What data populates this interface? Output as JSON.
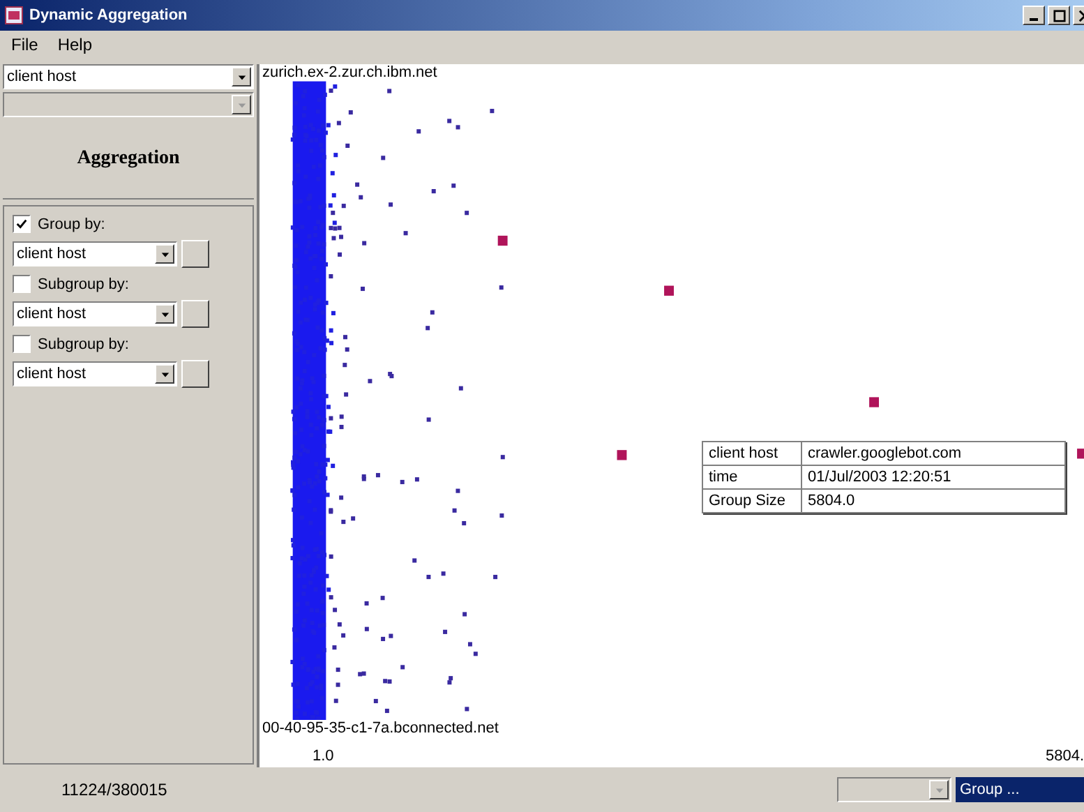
{
  "window": {
    "title": "Dynamic Aggregation"
  },
  "menu": [
    "File",
    "Help"
  ],
  "sidebar": {
    "attribute_combo": {
      "value": "client host"
    },
    "second_combo": {
      "disabled": true
    },
    "heading": "Aggregation",
    "groups": [
      {
        "label": "Group by:",
        "checked": true,
        "value": "client host"
      },
      {
        "label": "Subgroup by:",
        "checked": false,
        "value": "client host"
      },
      {
        "label": "Subgroup by:",
        "checked": false,
        "value": "client host"
      }
    ]
  },
  "plot": {
    "top_label": "zurich.ex-2.zur.ch.ibm.net",
    "bottom_label": "00-40-95-35-c1-7a.bconnected.net",
    "x_min": "1.0",
    "x_max": "5804.",
    "tooltip": [
      {
        "key": "client host",
        "value": "crawler.googlebot.com"
      },
      {
        "key": "time",
        "value": "01/Jul/2003 12:20:51"
      },
      {
        "key": "Group Size",
        "value": "5804.0"
      }
    ]
  },
  "status_bar": {
    "count": "11224/380015",
    "combo": {
      "disabled": true
    },
    "group_combo": {
      "value": "Group ..."
    }
  }
}
